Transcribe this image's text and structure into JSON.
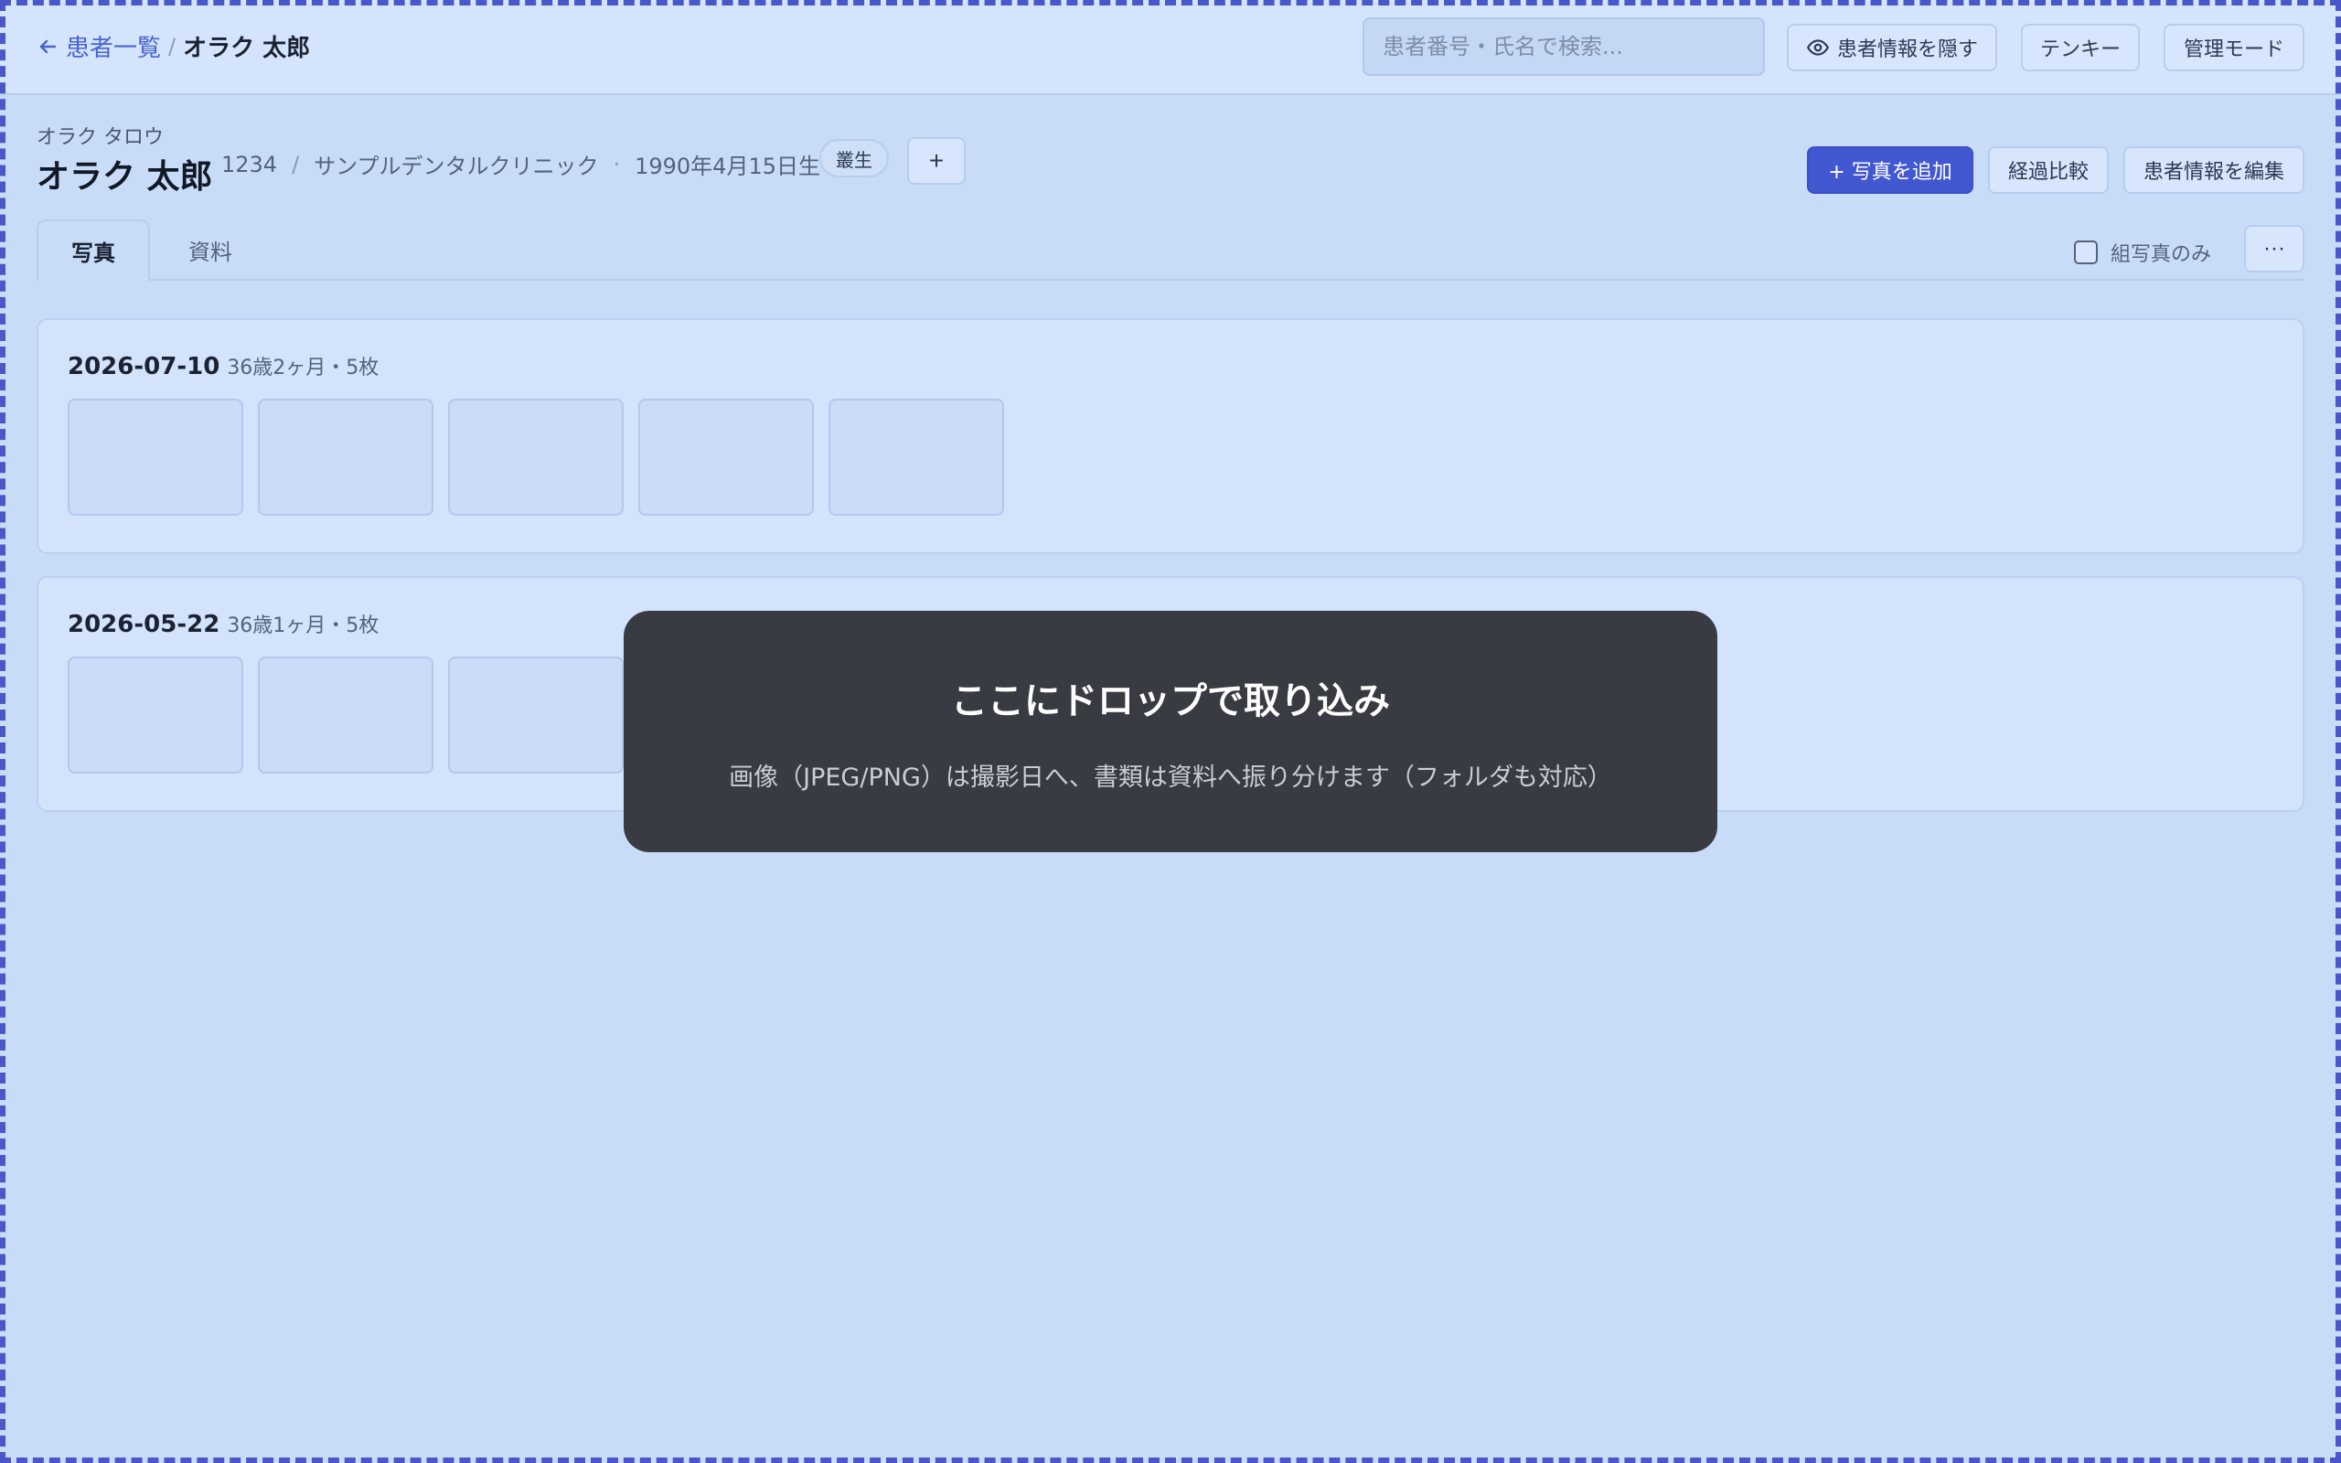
{
  "breadcrumb": {
    "back_label": "患者一覧",
    "separator": "/",
    "current": "オラク 太郎"
  },
  "search": {
    "placeholder": "患者番号・氏名で検索..."
  },
  "topbar": {
    "hide_info_label": "患者情報を隠す",
    "tenkey_label": "テンキー",
    "admin_label": "管理モード"
  },
  "patient": {
    "kana": "オラク タロウ",
    "name": "オラク 太郎",
    "number": "1234",
    "sep1": "/",
    "clinic": "サンプルデンタルクリニック",
    "sep2": "·",
    "birthdate": "1990年4月15日生",
    "tag": "叢生",
    "add_tag": "+"
  },
  "actions": {
    "add_photo": "+ 写真を追加",
    "compare": "経過比較",
    "edit_patient": "患者情報を編集"
  },
  "tabs": [
    {
      "label": "写真",
      "active": true
    },
    {
      "label": "資料",
      "active": false
    }
  ],
  "filter": {
    "combo_only_label": "組写真のみ",
    "checked": false
  },
  "more_label": "···",
  "groups": [
    {
      "date": "2026-07-10",
      "meta": "36歳2ヶ月・5枚",
      "thumbnail_count": 5
    },
    {
      "date": "2026-05-22",
      "meta": "36歳1ヶ月・5枚",
      "thumbnail_count": 5
    }
  ],
  "drop_overlay": {
    "title": "ここにドロップで取り込み",
    "description": "画像（JPEG/PNG）は撮影日へ、書類は資料へ振り分けます（フォルダも対応）"
  },
  "colors": {
    "accent": "#4258d1",
    "background": "#c9dcf7",
    "overlay": "#34363d",
    "frame": "#4b56c8"
  }
}
